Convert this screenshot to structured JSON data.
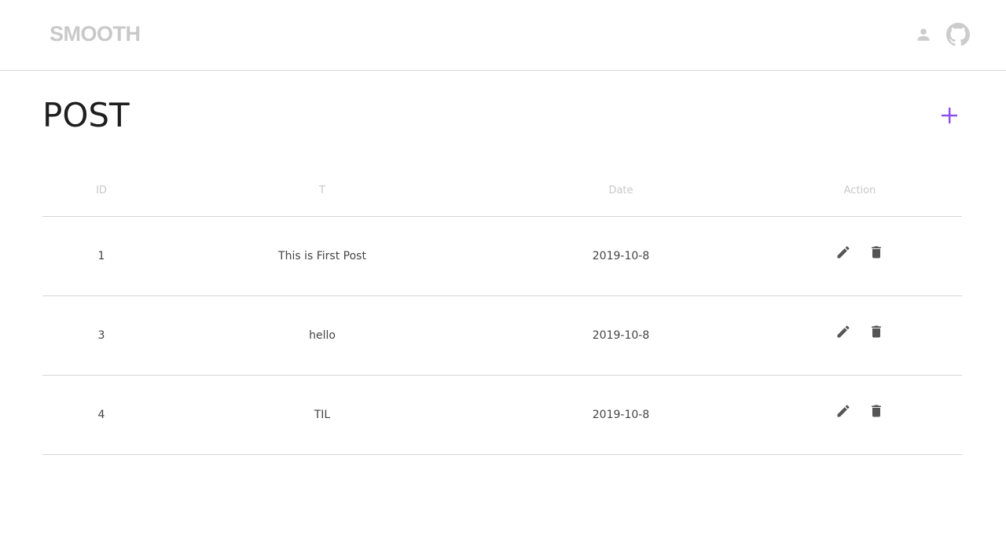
{
  "header": {
    "logo": "SMOOTH",
    "icons": [
      "user-icon",
      "github-icon"
    ]
  },
  "page": {
    "title": "POST",
    "add_icon": "plus-icon",
    "accent_color": "#8a4df0"
  },
  "table": {
    "columns": [
      "ID",
      "T",
      "Date",
      "Action"
    ],
    "rows": [
      {
        "id": "1",
        "title": "This is First Post",
        "date": "2019-10-8"
      },
      {
        "id": "3",
        "title": "hello",
        "date": "2019-10-8"
      },
      {
        "id": "4",
        "title": "TIL",
        "date": "2019-10-8"
      }
    ],
    "row_actions": [
      "edit-icon",
      "delete-icon"
    ]
  }
}
